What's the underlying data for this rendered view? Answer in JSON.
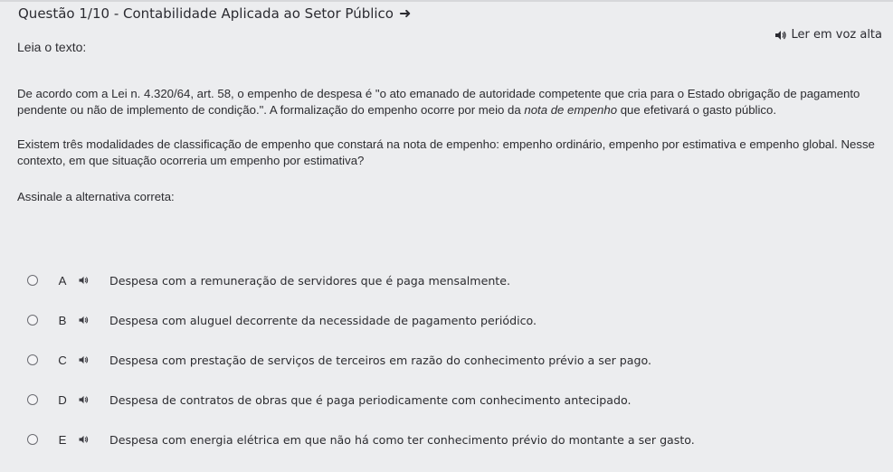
{
  "header": {
    "title": "Questão 1/10 - Contabilidade Aplicada ao Setor Público",
    "read_aloud_label": "Ler em voz alta"
  },
  "content": {
    "read_label": "Leia o texto:",
    "paragraph1_a": "De acordo com a Lei n. 4.320/64, art. 58, o empenho de despesa é \"o ato emanado de autoridade competente que cria para o Estado obrigação de pagamento pendente ou não de implemento de condição.\". A formalização do empenho ocorre por meio da ",
    "paragraph1_em": "nota de empenho",
    "paragraph1_b": " que efetivará o gasto público.",
    "paragraph2": "Existem três modalidades de classificação de empenho que constará na nota de empenho: empenho ordinário, empenho por estimativa e empenho global. Nesse contexto, em que situação ocorreria um empenho por estimativa?",
    "instruction": "Assinale a alternativa correta:"
  },
  "options": [
    {
      "letter": "A",
      "text": "Despesa com a remuneração de servidores que é paga mensalmente."
    },
    {
      "letter": "B",
      "text": "Despesa com aluguel decorrente da necessidade de pagamento periódico."
    },
    {
      "letter": "C",
      "text": "Despesa com prestação de serviços de terceiros em razão do conhecimento prévio a ser pago."
    },
    {
      "letter": "D",
      "text": "Despesa de contratos de obras que é paga periodicamente com conhecimento antecipado."
    },
    {
      "letter": "E",
      "text": "Despesa com energia elétrica em que não há como ter conhecimento prévio do montante a ser gasto."
    }
  ],
  "icons": {
    "title_arrow": "arrow-right-icon",
    "speaker": "speaker-icon"
  }
}
